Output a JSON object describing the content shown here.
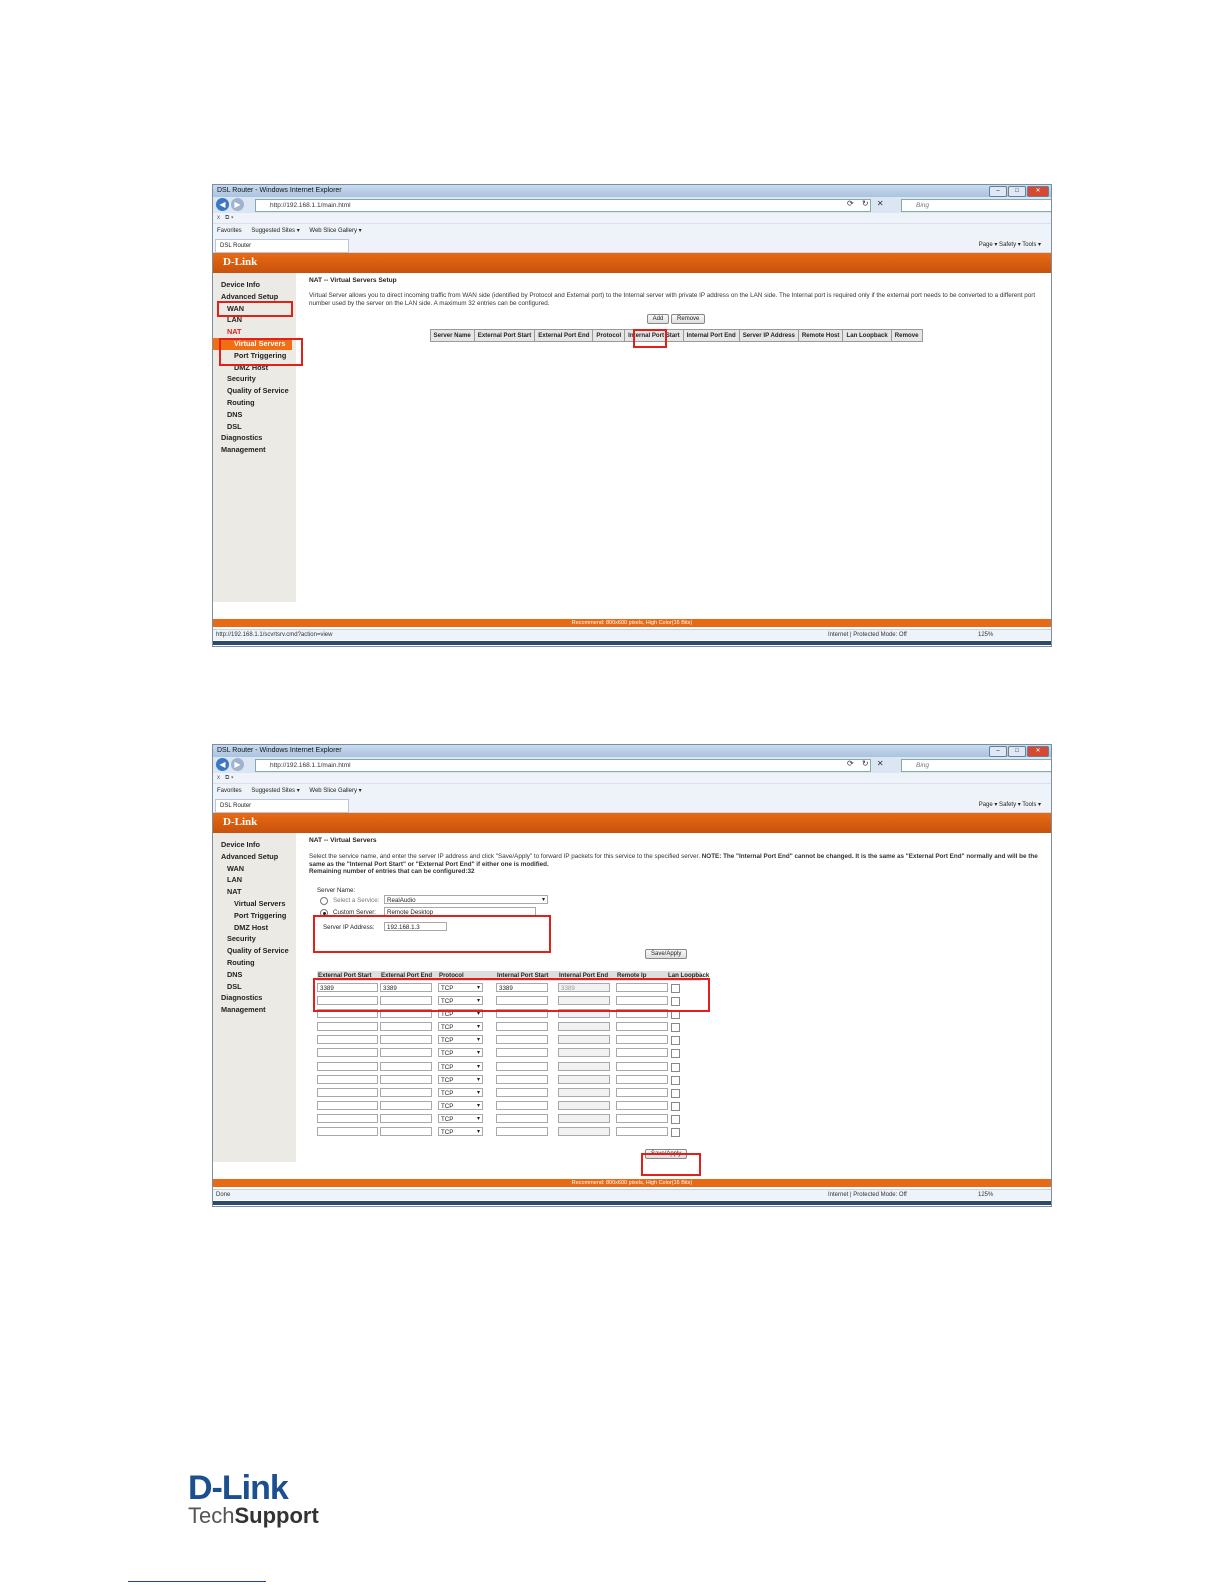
{
  "browser": {
    "window_title": "DSL Router - Windows Internet Explorer",
    "url": "http://192.168.1.1/main.html",
    "search_placeholder": "Bing",
    "favorites_label": "Favorites",
    "suggested_sites": "Suggested Sites ▾",
    "web_slice_gallery": "Web Slice Gallery ▾",
    "tab_title": "DSL Router",
    "command_bar": "Page ▾  Safety ▾  Tools ▾",
    "zone": "Internet | Protected Mode: Off",
    "zoom": "125%"
  },
  "router": {
    "brand": "D-Link",
    "footer": "Recommend: 800x600 pixels, High Color(16 Bits)",
    "menu": [
      {
        "label": "Device Info",
        "level": 0
      },
      {
        "label": "Advanced Setup",
        "level": 0
      },
      {
        "label": "WAN",
        "level": 1
      },
      {
        "label": "LAN",
        "level": 1
      },
      {
        "label": "NAT",
        "level": 1
      },
      {
        "label": "Virtual Servers",
        "level": 2
      },
      {
        "label": "Port Triggering",
        "level": 2
      },
      {
        "label": "DMZ Host",
        "level": 2
      },
      {
        "label": "Security",
        "level": 1
      },
      {
        "label": "Quality of Service",
        "level": 1
      },
      {
        "label": "Routing",
        "level": 1
      },
      {
        "label": "DNS",
        "level": 1
      },
      {
        "label": "DSL",
        "level": 1
      },
      {
        "label": "Diagnostics",
        "level": 0
      },
      {
        "label": "Management",
        "level": 0
      }
    ]
  },
  "screen1": {
    "status_url": "http://192.168.1.1/scvrtsrv.cmd?action=view",
    "title": "NAT -- Virtual Servers Setup",
    "description": "Virtual Server allows you to direct incoming traffic from WAN side (identified by Protocol and External port) to the Internal server with private IP address on the LAN side. The Internal port is required only if the external port needs to be converted to a different port number used by the server on the LAN side. A maximum 32 entries can be configured.",
    "add_button": "Add",
    "remove_button": "Remove",
    "columns": [
      "Server Name",
      "External Port Start",
      "External Port End",
      "Protocol",
      "Internal Port Start",
      "Internal Port End",
      "Server IP Address",
      "Remote Host",
      "Lan Loopback",
      "Remove"
    ]
  },
  "screen2": {
    "status_text": "Done",
    "title": "NAT -- Virtual Servers",
    "description_plain": "Select the service name, and enter the server IP address and click \"Save/Apply\" to forward IP packets for this service to the specified server. ",
    "description_note": "NOTE: The \"Internal Port End\" cannot be changed. It is the same as \"External Port End\" normally and will be the same as the \"Internal Port Start\" or \"External Port End\" if either one is modified.",
    "remaining": "Remaining number of entries that can be configured:32",
    "server_name_label": "Server Name:",
    "select_service_label": "Select a Service:",
    "select_service_value": "RealAudio",
    "custom_server_label": "Custom Server:",
    "custom_server_value": "Remote Desktop",
    "server_ip_label": "Server IP Address:",
    "server_ip_value": "192.168.1.3",
    "save_apply": "Save/Apply",
    "columns": [
      "External Port Start",
      "External Port End",
      "Protocol",
      "Internal Port Start",
      "Internal Port End",
      "Remote Ip",
      "Lan Loopback"
    ],
    "first_row": {
      "ext_start": "3389",
      "ext_end": "3389",
      "protocol": "TCP",
      "int_start": "3389",
      "int_end": "3389"
    },
    "protocol_default": "TCP",
    "row_count": 12
  },
  "logo": {
    "main": "D-Link",
    "tech": "Tech",
    "support": "Support"
  }
}
